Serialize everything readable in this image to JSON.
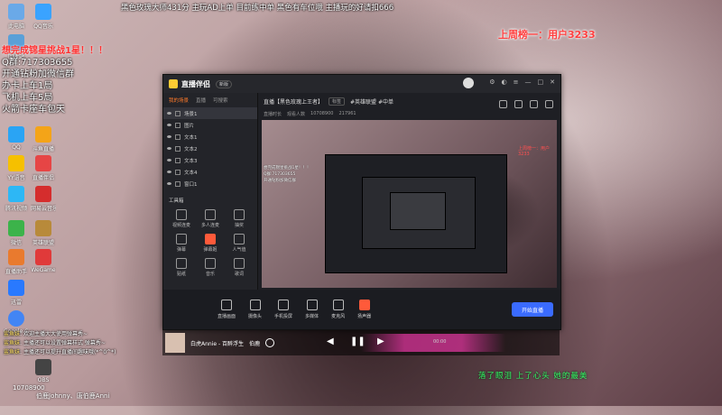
{
  "desktop_icons": [
    {
      "label": "此电脑",
      "color": "#6aa9e8"
    },
    {
      "label": "QQ音乐",
      "color": "#3aa3ff"
    },
    {
      "label": "回收站",
      "color": "#5aa0d8"
    },
    {
      "label": "QQ",
      "color": "#2aa4f4"
    },
    {
      "label": "斗鱼直播",
      "color": "#f4a418"
    },
    {
      "label": "YY语音",
      "color": "#f6c000"
    },
    {
      "label": "直播伴侣",
      "color": "#e64545"
    },
    {
      "label": "腾讯视频",
      "color": "#2db7f5"
    },
    {
      "label": "网易云音乐",
      "color": "#d52d2d"
    },
    {
      "label": "微信",
      "color": "#3cb34a"
    },
    {
      "label": "英雄联盟",
      "color": "#b88a3a"
    },
    {
      "label": "直播助手",
      "color": "#e97a2e"
    },
    {
      "label": "WeGame",
      "color": "#e03a3a"
    },
    {
      "label": "迅雷",
      "color": "#2979ff"
    },
    {
      "label": "Google Chrome",
      "color": "#4285f4"
    },
    {
      "label": "OBS",
      "color": "#444444"
    }
  ],
  "overlay": {
    "top_banner": "黑色玫瑰大师431分 主玩AD上单 目前练中单 黑色有车位哦   主播玩的好请扣666",
    "top_rank": "上周榜一：用户3233",
    "lines": [
      "想完成锦星挑战1星！！！",
      "Q群:717303655",
      "开通钻粉加微信群",
      "办卡上车1局",
      "飞机上车5局",
      "火箭卡座车包天"
    ]
  },
  "app": {
    "name": "直播伴侣",
    "badge": "新版",
    "tabs": [
      "我的场景",
      "直播",
      "可搜索"
    ],
    "scenes": [
      "场景1",
      "图片",
      "文本1",
      "文本2",
      "文本3",
      "文本4",
      "窗口1"
    ],
    "toolbox_title": "工具箱",
    "tools": [
      "视频连麦",
      "多人连麦",
      "抽奖",
      "弹幕",
      "弹幕姬",
      "人气值",
      "贴纸",
      "音乐",
      "歌词"
    ],
    "stream_title": "直播【黑色玫瑰上王者】",
    "stream_tag": "标签",
    "stream_category": "#英雄联盟 #中单",
    "stream_meta": [
      "直播时长",
      "观看人数",
      "10708900",
      "217961"
    ],
    "bottom_tools": [
      "直播画面",
      "摄像头",
      "手机投屏",
      "多媒体",
      "麦克风",
      "扬声器"
    ],
    "start_label": "开始直播"
  },
  "player": {
    "song": "白虎Annie - 百醉浮生",
    "artist": "伯鹿",
    "time": "00:00"
  },
  "chat": [
    {
      "name": "鲨鱼妹",
      "text": "欢迎主播大大使用弹幕秀~"
    },
    {
      "name": "鲨鱼妹",
      "text": "主播还可以设置弹幕样式 弹幕秀~"
    },
    {
      "name": "鲨鱼妹",
      "text": "主播还可以提升直播间趣味哦(*^0^*)"
    }
  ],
  "room_id": "10708900",
  "bottom_names": "伯鹿Johnny、唐伯鹿Anni",
  "caption": "落了眼泪  上了心头  她的最美"
}
